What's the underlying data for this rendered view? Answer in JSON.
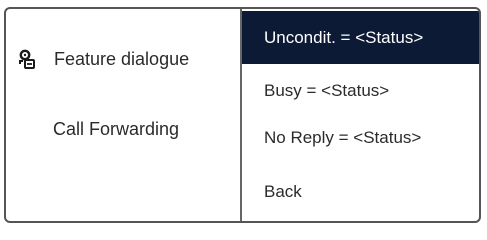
{
  "left_panel": {
    "items": [
      {
        "label": "Feature dialogue",
        "icon": "feature-dialogue-icon"
      },
      {
        "label": "Call Forwarding"
      }
    ]
  },
  "menu": {
    "items": [
      {
        "label": "Uncondit. = <Status>",
        "selected": true
      },
      {
        "label": "Busy = <Status>",
        "selected": false
      },
      {
        "label": "No Reply = <Status>",
        "selected": false
      },
      {
        "label": "Back",
        "selected": false
      }
    ]
  },
  "colors": {
    "selected_bg": "#0d1a35",
    "selected_text": "#ffffff",
    "text": "#2b2b2b",
    "border": "#555555"
  }
}
